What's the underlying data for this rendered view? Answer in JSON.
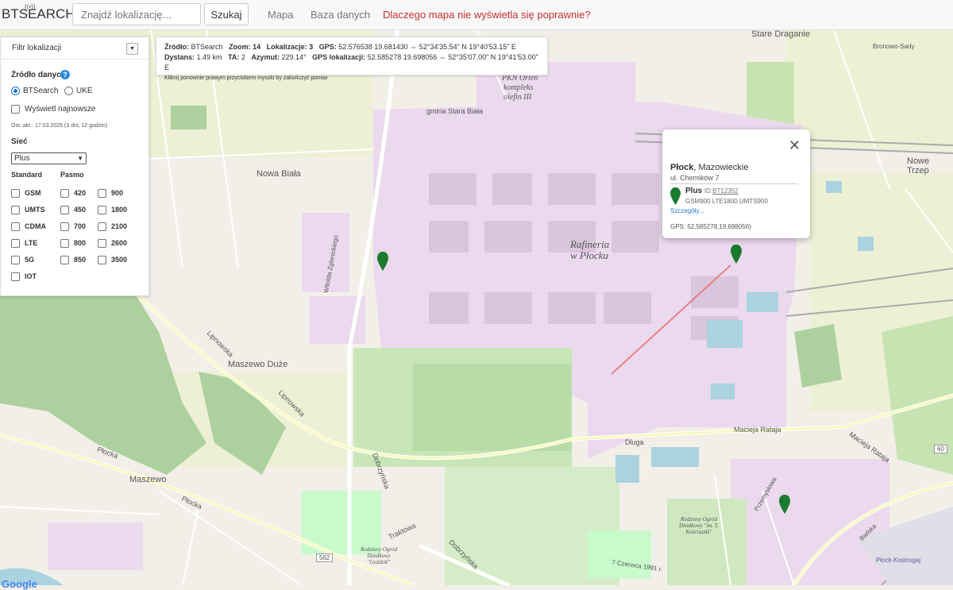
{
  "app": {
    "logo": "BTSEARCH"
  },
  "header": {
    "search_placeholder": "Znajdź lokalizację...",
    "search_button": "Szukaj",
    "nav_map": "Mapa",
    "nav_db": "Baza danych",
    "nav_warning": "Dlaczego mapa nie wyświetla się poprawnie?"
  },
  "filter_panel": {
    "title": "Filtr lokalizacji",
    "source_label": "Źródło danych",
    "source_options": [
      "BTSearch",
      "UKE"
    ],
    "source_selected": "BTSearch",
    "show_newest": "Wyświetl najnowsze",
    "last_update": "Ost. akt.: 17.03.2025 (3 dni, 12 godzin)",
    "network_label": "Sieć",
    "network_selected": "Plus",
    "standard_label": "Standard",
    "band_label": "Pasmo",
    "standards": [
      "GSM",
      "UMTS",
      "CDMA",
      "LTE",
      "5G",
      "IOT"
    ],
    "bands_col1": [
      "420",
      "450",
      "700",
      "800",
      "850"
    ],
    "bands_col2": [
      "900",
      "1800",
      "2100",
      "2600",
      "3500"
    ]
  },
  "measure_box": {
    "line1_source_label": "Źródło:",
    "line1_source": "BTSearch",
    "line1_zoom_label": "Zoom:",
    "line1_zoom": "14",
    "line1_loc_label": "Lokalizacje:",
    "line1_loc": "3",
    "line1_gps_label": "GPS:",
    "line1_gps": "52.576538 19.681430 ⇔ 52°34'35.54\" N 19°40'53.15\" E",
    "line2_dist_label": "Dystans:",
    "line2_dist": "1.49 km",
    "line2_ta_label": "TA:",
    "line2_ta": "2",
    "line2_az_label": "Azymut:",
    "line2_az": "229.14°",
    "line2_gpsloc_label": "GPS lokalizacji:",
    "line2_gpsloc": "52.585278 19.698056 ⇔ 52°35'07.00\" N 19°41'53.00\" E",
    "hint": "Kliknij ponownie prawym przyciskiem myszki by zakończyć pomiar"
  },
  "popup": {
    "city": "Płock",
    "region": ", Mazowieckie",
    "street": "ul. Chemików 7",
    "network": "Plus",
    "id_label": "ID:",
    "id": "BT12352",
    "techs": "GSM900 LTE1800 UMTS900",
    "details": "Szczegóły...",
    "gps": "GPS: 52,585278,19,698056)"
  },
  "map_labels": {
    "refinery": "Rafineria",
    "refinery2": "w Płocku",
    "orlen1": "PKN Orlen",
    "orlen2": "kompleks",
    "orlen3": "olefin III",
    "stara_biala": "gmina Stara Biała",
    "nowa_biala": "Nowa Biała",
    "maszewo_duze": "Maszewo Duże",
    "maszewo": "Maszewo",
    "stare_draganie": "Stare Draganie",
    "bronowo": "Bronowo-Sady",
    "nowe_trzep": "Nowe Trzep",
    "dluga": "Długa",
    "macieja": "Macieja Rataja",
    "plocka": "Płocka",
    "plocka2": "Płocka",
    "lipnowska": "Lipnowska",
    "dobrzynska": "Dobrzyńska",
    "traktowa": "Traktowa",
    "przemyslowa": "Przemysłowa",
    "bielska": "Bielska",
    "czerwca": "7 Czerwca 1991 r.",
    "plock_kostrogaj": "Płock-Kostrogaj",
    "road562": "562",
    "road60": "60",
    "witolda": "Witolda Zglenickiego",
    "ogrod1": "Rodzinny Ogród Działkowy \"im. T. Kościuszki\"",
    "ogrod2": "Rodzinny Ogród Działkowy \"Goździk\"",
    "google": "Google"
  },
  "colors": {
    "industrial": "#ebd9ee",
    "map_bg": "#f2efe9",
    "forest": "#add19e",
    "park": "#c8facc",
    "marker": "#1a7a2e",
    "warning": "#c9302c",
    "link": "#1a73e8"
  }
}
